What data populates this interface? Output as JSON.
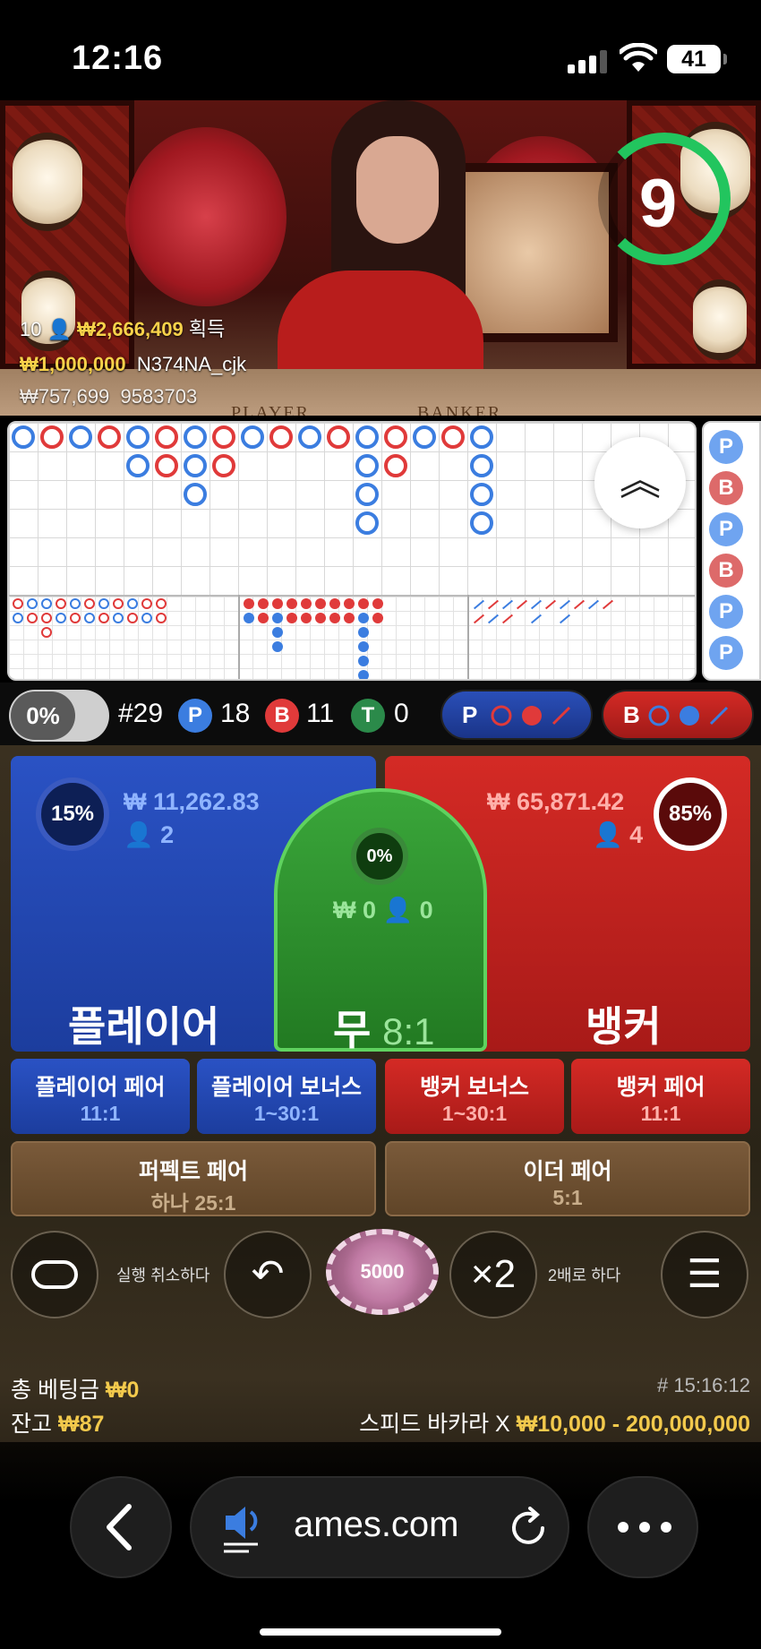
{
  "status_bar": {
    "time": "12:16",
    "battery": "41"
  },
  "video": {
    "countdown": "9",
    "winners": [
      {
        "rank": "10",
        "amount": "₩2,666,409",
        "suffix": "획득"
      },
      {
        "amount": "₩1,000,000",
        "name": "N374NA_cjk"
      },
      {
        "amount": "₩757,699",
        "name": "9583703"
      }
    ],
    "table_labels": {
      "player": "PLAYER",
      "banker": "BANKER"
    }
  },
  "road_side_beads": [
    "P",
    "B",
    "P",
    "B",
    "P",
    "P"
  ],
  "stats": {
    "percent_toggle": "0%",
    "round": "#29",
    "player_badge": "P",
    "player_count": "18",
    "banker_badge": "B",
    "banker_count": "11",
    "tie_badge": "T",
    "tie_count": "0",
    "predict_player": "P",
    "predict_banker": "B"
  },
  "bets": {
    "player": {
      "percent": "15%",
      "amount": "₩ 11,262.83",
      "players": "2",
      "label": "플레이어"
    },
    "tie": {
      "percent": "0%",
      "amount": "₩ 0",
      "players": "0",
      "label": "무",
      "payout": "8:1"
    },
    "banker": {
      "percent": "85%",
      "amount": "₩ 65,871.42",
      "players": "4",
      "label": "뱅커"
    },
    "side": [
      {
        "title": "플레이어 페어",
        "payout": "11:1"
      },
      {
        "title": "플레이어 보너스",
        "payout": "1~30:1"
      },
      {
        "title": "뱅커 보너스",
        "payout": "1~30:1"
      },
      {
        "title": "뱅커 페어",
        "payout": "11:1"
      }
    ],
    "perfect_pair": {
      "title": "퍼펙트 페어",
      "payout": "하나 25:1"
    },
    "either_pair": {
      "title": "이더 페어",
      "payout": "5:1"
    }
  },
  "controls": {
    "undo_label": "실행 취소하다",
    "chip_value": "5000",
    "double_button": "×2",
    "double_label": "2배로 하다"
  },
  "footer": {
    "total_bet_label": "총 베팅금",
    "total_bet": "₩0",
    "balance_label": "잔고",
    "balance": "₩87",
    "round_time": "# 15:16:12",
    "game_name": "스피드 바카라 X",
    "limits": "₩10,000 - 200,000,000"
  },
  "browser": {
    "url": "ames.com"
  }
}
